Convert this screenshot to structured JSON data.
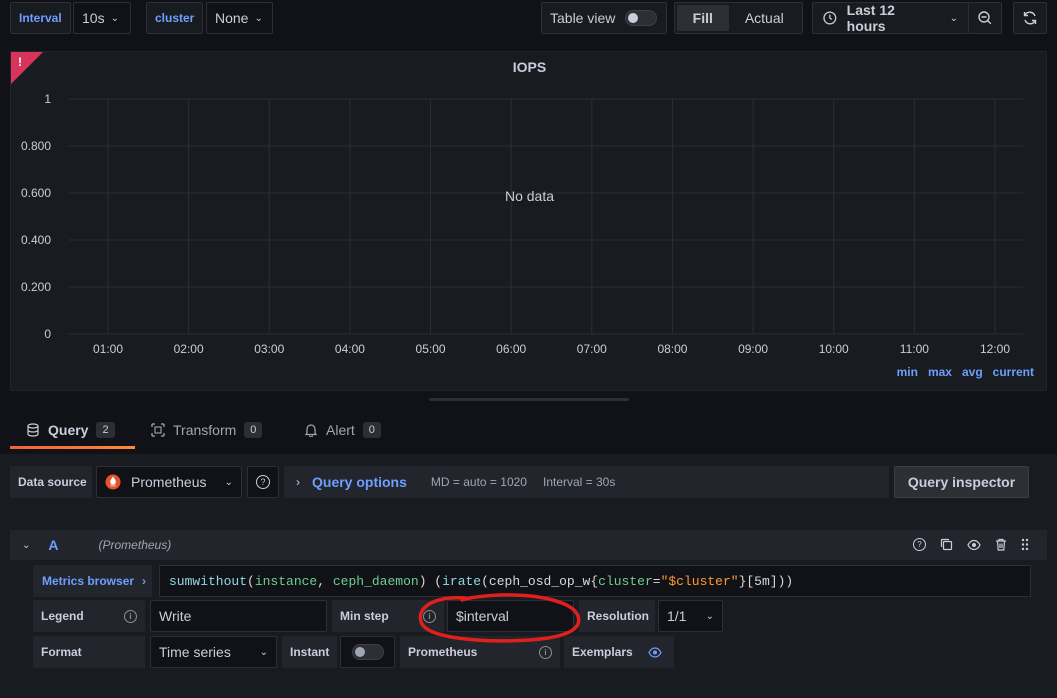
{
  "toolbar": {
    "interval_label": "Interval",
    "interval_value": "10s",
    "cluster_label": "cluster",
    "cluster_value": "None",
    "table_view_label": "Table view",
    "fill_label": "Fill",
    "actual_label": "Actual",
    "time_range": "Last 12 hours"
  },
  "panel": {
    "title": "IOPS",
    "no_data": "No data",
    "legend": [
      "min",
      "max",
      "avg",
      "current"
    ]
  },
  "chart_data": {
    "type": "line",
    "title": "IOPS",
    "x_ticks": [
      "01:00",
      "02:00",
      "03:00",
      "04:00",
      "05:00",
      "06:00",
      "07:00",
      "08:00",
      "09:00",
      "10:00",
      "11:00",
      "12:00"
    ],
    "y_ticks": [
      "0",
      "0.200",
      "0.400",
      "0.600",
      "0.800",
      "1"
    ],
    "ylim": [
      0,
      1
    ],
    "grid": true,
    "series": [],
    "annotation": "No data",
    "legend_values": [
      "min",
      "max",
      "avg",
      "current"
    ]
  },
  "tabs": [
    {
      "label": "Query",
      "count": "2"
    },
    {
      "label": "Transform",
      "count": "0"
    },
    {
      "label": "Alert",
      "count": "0"
    }
  ],
  "datasource": {
    "label": "Data source",
    "value": "Prometheus",
    "query_options_label": "Query options",
    "md": "MD = auto = 1020",
    "interval": "Interval = 30s",
    "inspector_label": "Query inspector"
  },
  "query": {
    "ref": "A",
    "source": "(Prometheus)",
    "metrics_browser": "Metrics browser",
    "expr": {
      "sum": "sum",
      "without": "without",
      "p1": "(",
      "instance": "instance",
      "comma": ", ",
      "ceph_daemon": "ceph_daemon",
      "p2": ") (",
      "irate": "irate",
      "p3": "(ceph_osd_op_w{",
      "cluster_key": "cluster",
      "eq": "=",
      "cluster_val": "\"$cluster\"",
      "tail": "}[5m]))"
    },
    "legend_label": "Legend",
    "legend_value": "Write",
    "min_step_label": "Min step",
    "min_step_value": "$interval",
    "resolution_label": "Resolution",
    "resolution_value": "1/1",
    "format_label": "Format",
    "format_value": "Time series",
    "instant_label": "Instant",
    "prometheus_label": "Prometheus",
    "exemplars_label": "Exemplars"
  }
}
